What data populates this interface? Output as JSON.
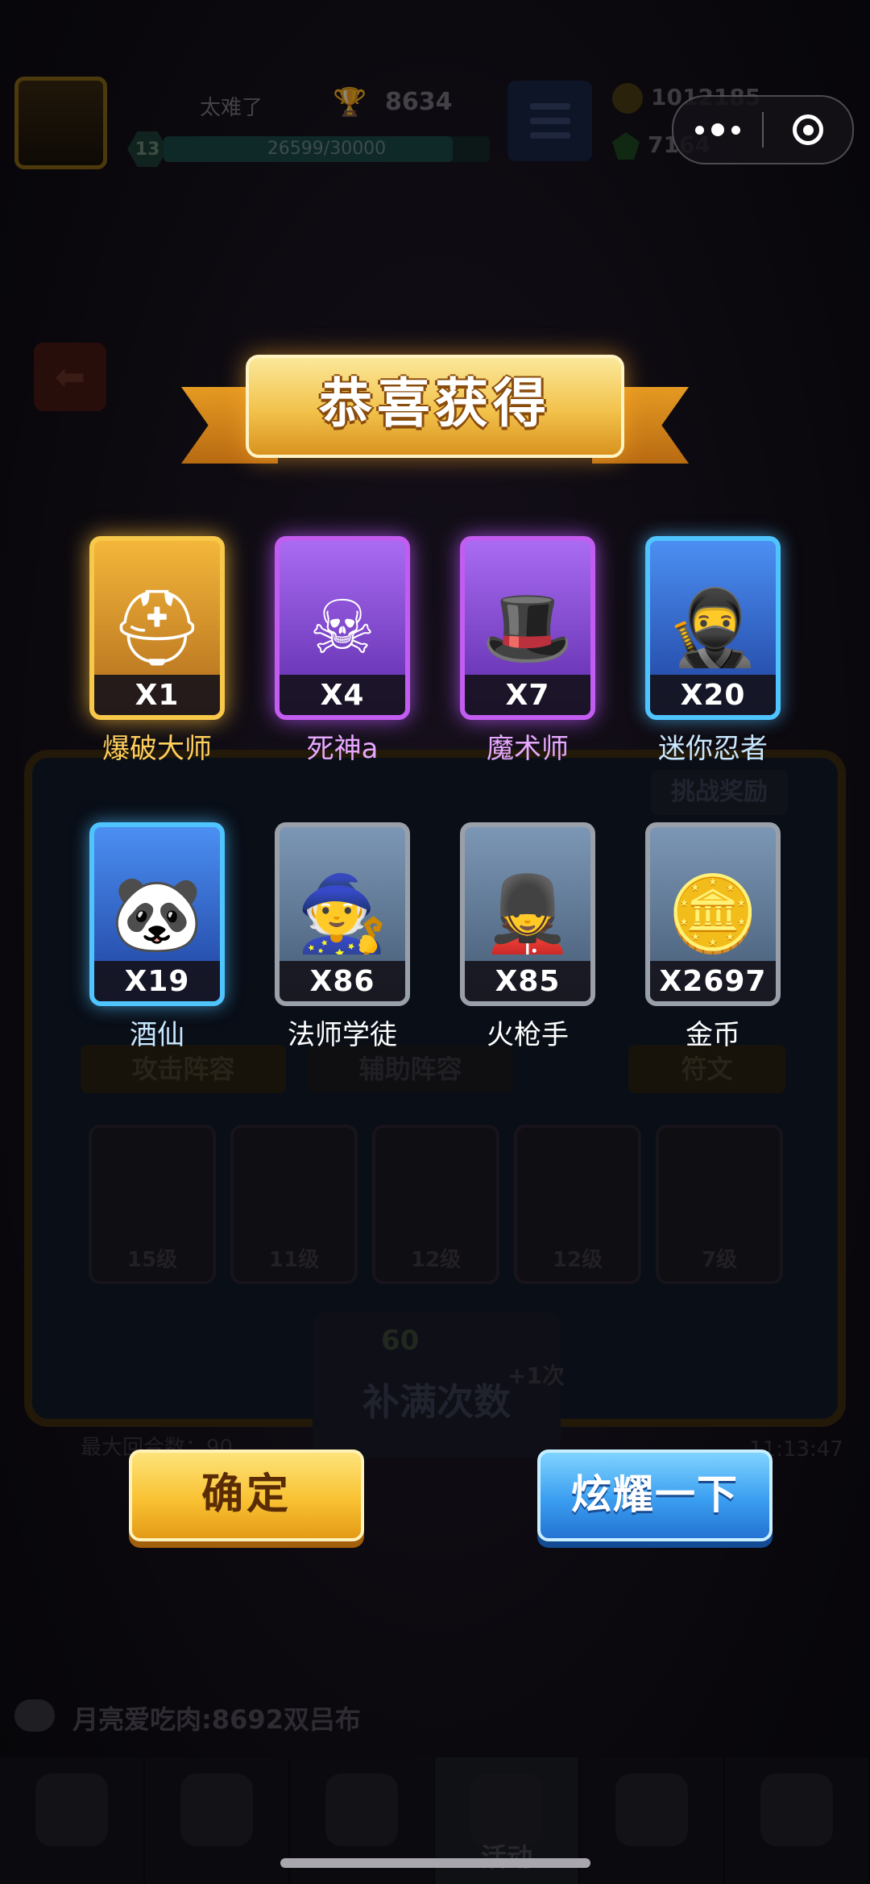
{
  "background": {
    "player": {
      "name": "太难了",
      "trophies": "8634",
      "level": "13",
      "xp_text": "26599/30000",
      "xp_fraction": 0.887
    },
    "currencies": {
      "coins": "1012185",
      "gems": "7164"
    },
    "team_tabs": {
      "attack": "攻击阵容",
      "support": "辅助阵容",
      "rune": "符文"
    },
    "challenge_reward": "挑战奖励",
    "hero_levels": [
      "15级",
      "11级",
      "12级",
      "12级",
      "7级"
    ],
    "refill": {
      "cost": "60",
      "label": "补满次数",
      "plus_count": "+1次"
    },
    "max_rounds": "最大回合数：90",
    "timer": "11:13:47",
    "chat_message": "月亮爱吃肉:8692双吕布",
    "nav_active_label": "活动"
  },
  "modal": {
    "title": "恭喜获得",
    "rewards": [
      {
        "name": "爆破大师",
        "qty": "X1",
        "rarity": "gold",
        "icon": "miner-helmet-hero-icon"
      },
      {
        "name": "死神a",
        "qty": "X4",
        "rarity": "purple",
        "icon": "skull-reaper-icon"
      },
      {
        "name": "魔术师",
        "qty": "X7",
        "rarity": "purple",
        "icon": "magician-top-hat-icon"
      },
      {
        "name": "迷你忍者",
        "qty": "X20",
        "rarity": "blue",
        "icon": "mini-ninja-icon"
      },
      {
        "name": "酒仙",
        "qty": "X19",
        "rarity": "blue",
        "icon": "panda-drunken-master-icon"
      },
      {
        "name": "法师学徒",
        "qty": "X86",
        "rarity": "gray",
        "icon": "apprentice-wizard-icon"
      },
      {
        "name": "火枪手",
        "qty": "X85",
        "rarity": "gray",
        "icon": "musketeer-icon"
      },
      {
        "name": "金币",
        "qty": "X2697",
        "rarity": "gray",
        "icon": "gold-coins-icon"
      }
    ],
    "confirm_label": "确定",
    "share_label": "炫耀一下"
  },
  "colors": {
    "gold": "#f7c84a",
    "purple": "#c35cf0",
    "blue": "#4fc4ff",
    "gray": "#9aa0aa"
  }
}
